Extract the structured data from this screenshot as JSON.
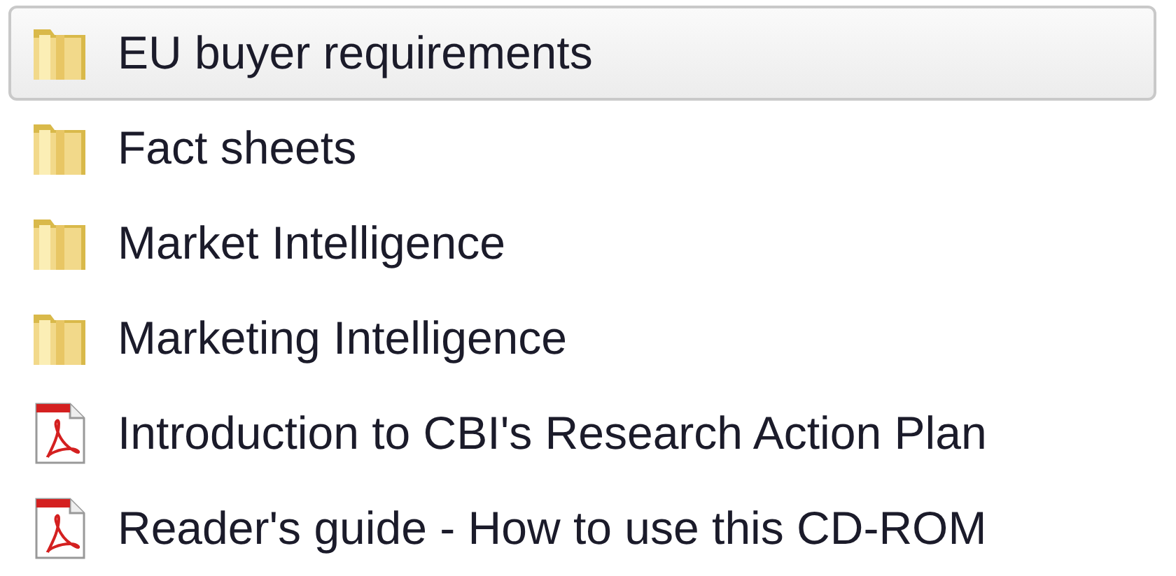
{
  "files": [
    {
      "kind": "folder",
      "name": "EU buyer requirements",
      "selected": true
    },
    {
      "kind": "folder",
      "name": "Fact sheets",
      "selected": false
    },
    {
      "kind": "folder",
      "name": "Market Intelligence",
      "selected": false
    },
    {
      "kind": "folder",
      "name": "Marketing Intelligence",
      "selected": false
    },
    {
      "kind": "pdf",
      "name": "Introduction to CBI's Research Action Plan",
      "selected": false
    },
    {
      "kind": "pdf",
      "name": "Reader's guide - How to use this CD-ROM",
      "selected": false
    }
  ]
}
